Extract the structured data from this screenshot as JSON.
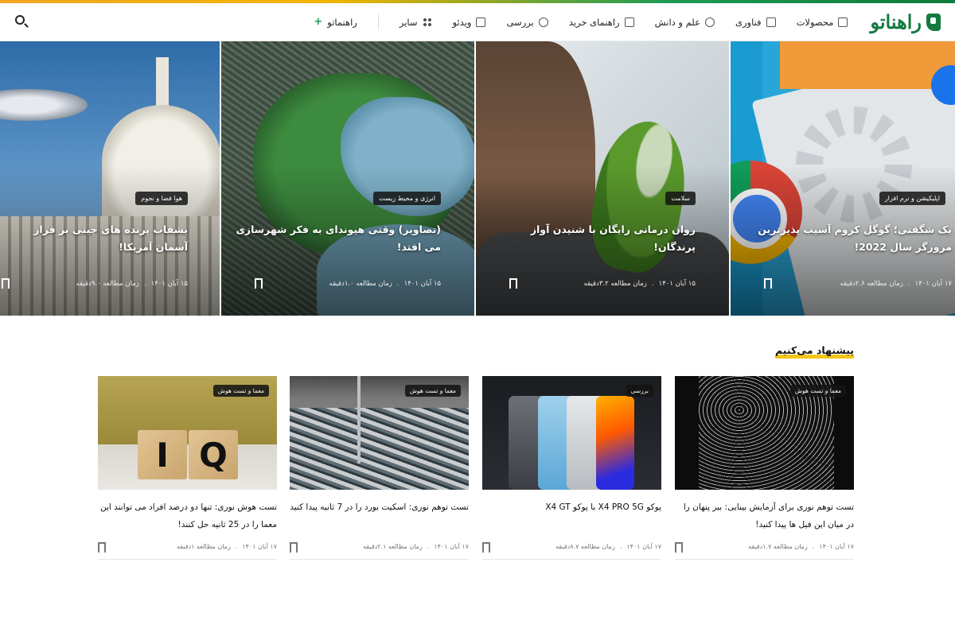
{
  "brand": {
    "logo_text": "راهناتو"
  },
  "nav": {
    "items": [
      {
        "label": "محصولات",
        "icon": "box-icon"
      },
      {
        "label": "فناوری",
        "icon": "chip-icon"
      },
      {
        "label": "علم و دانش",
        "icon": "telescope-icon"
      },
      {
        "label": "راهنمای خرید",
        "icon": "cart-icon"
      },
      {
        "label": "بررسی",
        "icon": "scan-icon"
      },
      {
        "label": "ویدئو",
        "icon": "play-icon"
      },
      {
        "label": "سایر",
        "icon": "grid-icon"
      }
    ],
    "extra": {
      "label": "راهنماتو",
      "prefix": "+"
    }
  },
  "hero": [
    {
      "tag": "اپلیکیشن و نرم افزار",
      "title": "یک شگفتی؛ گوگل کروم آسیب پذیرترین مرورگر سال 2022!",
      "date": "۱۷ آبان ۱۴۰۱",
      "read_time": "زمان مطالعه ۲.۶دقیقه"
    },
    {
      "tag": "سلامت",
      "title": "روان درمانی رایگان با شنیدن آواز پرندگان!",
      "date": "۱۵ آبان ۱۴۰۱",
      "read_time": "زمان مطالعه ۳.۲دقیقه"
    },
    {
      "tag": "انرژی و محیط زیست",
      "title": "(تصاویر) وقتی هیوندای به فکر شهرسازی می افتد!",
      "date": "۱۵ آبان ۱۴۰۱",
      "read_time": "زمان مطالعه ۱.۰دقیقه"
    },
    {
      "tag": "هوا فضا و نجوم",
      "title": "بشقاب پرنده های چینی بر فراز آسمان آمریکا!",
      "date": "۱۵ آبان ۱۴۰۱",
      "read_time": "زمان مطالعه ۹.۰دقیقه"
    }
  ],
  "section": {
    "title": "پیشنهاد می‌کنیم"
  },
  "cards": [
    {
      "tag": "معما و تست هوش",
      "title": "تست توهم نوری برای آزمایش بینایی: ببر پنهان را در میان این فیل ها پیدا کنید!",
      "date": "۱۷ آبان ۱۴۰۱",
      "read_time": "زمان مطالعه ۱.۷دقیقه"
    },
    {
      "tag": "بررسی",
      "title": "پوکو X4 PRO 5G با پوکو X4 GT",
      "date": "۱۷ آبان ۱۴۰۱",
      "read_time": "زمان مطالعه ۸.۷دقیقه"
    },
    {
      "tag": "معما و تست هوش",
      "title": "تست توهم نوری: اسکیت بورد را در 7 ثانیه پیدا کنید",
      "date": "۱۷ آبان ۱۴۰۱",
      "read_time": "زمان مطالعه ۲.۱دقیقه"
    },
    {
      "tag": "معما و تست هوش",
      "title": "تست هوش نوری: تنها دو درصد افراد می توانند این معما را در 25 ثانیه حل کنند!",
      "date": "۱۷ آبان ۱۴۰۱",
      "read_time": "زمان مطالعه ۱دقیقه"
    }
  ],
  "iq_letters": {
    "first": "I",
    "second": "Q"
  },
  "colors": {
    "brand": "#137a3f",
    "accent": "#f5c518",
    "stripe_start": "#f5a623",
    "stripe_end": "#0f7a3e"
  }
}
